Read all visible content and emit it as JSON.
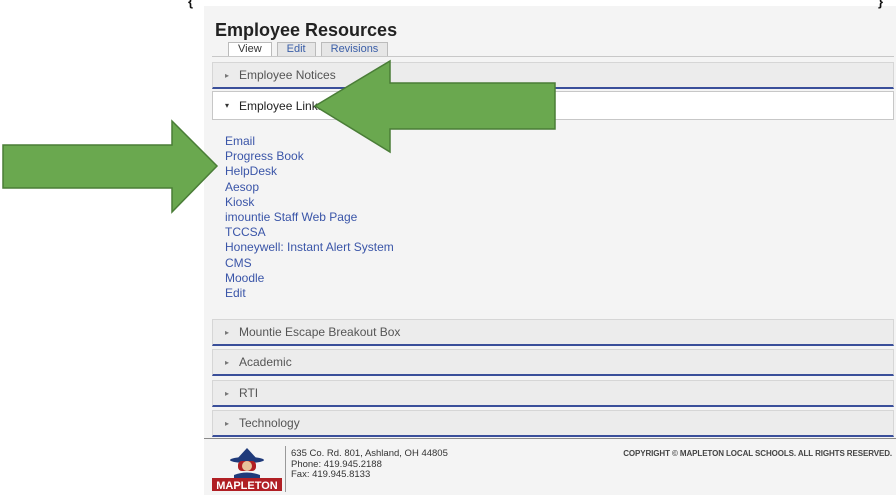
{
  "page": {
    "title": "Employee Resources",
    "tabs": [
      {
        "label": "View",
        "active": true
      },
      {
        "label": "Edit",
        "active": false
      },
      {
        "label": "Revisions",
        "active": false
      }
    ]
  },
  "accordion": {
    "caret_closed": "▸",
    "caret_open": "▾",
    "sections_top": [
      {
        "label": "Employee Notices",
        "expanded": false
      },
      {
        "label": "Employee Links",
        "expanded": true
      }
    ],
    "links": [
      "Email",
      "Progress Book",
      "HelpDesk",
      "Aesop",
      "Kiosk",
      "imountie Staff Web Page",
      "TCCSA",
      "Honeywell: Instant Alert System",
      "CMS",
      "Moodle",
      "Edit"
    ],
    "sections_bottom": [
      {
        "label": "Mountie Escape Breakout Box",
        "expanded": false
      },
      {
        "label": "Academic",
        "expanded": false
      },
      {
        "label": "RTI",
        "expanded": false
      },
      {
        "label": "Technology",
        "expanded": false
      }
    ]
  },
  "footer": {
    "address": "635 Co. Rd. 801, Ashland, OH 44805",
    "phone": "Phone: 419.945.2188",
    "fax": "Fax: 419.945.8133",
    "copyright": "COPYRIGHT © MAPLETON LOCAL SCHOOLS. ALL RIGHTS RESERVED.",
    "logo_text": "MAPLETON"
  },
  "colors": {
    "arrow": "#6aa84f",
    "link": "#3a55a8",
    "accent_border": "#3a4f9a"
  }
}
